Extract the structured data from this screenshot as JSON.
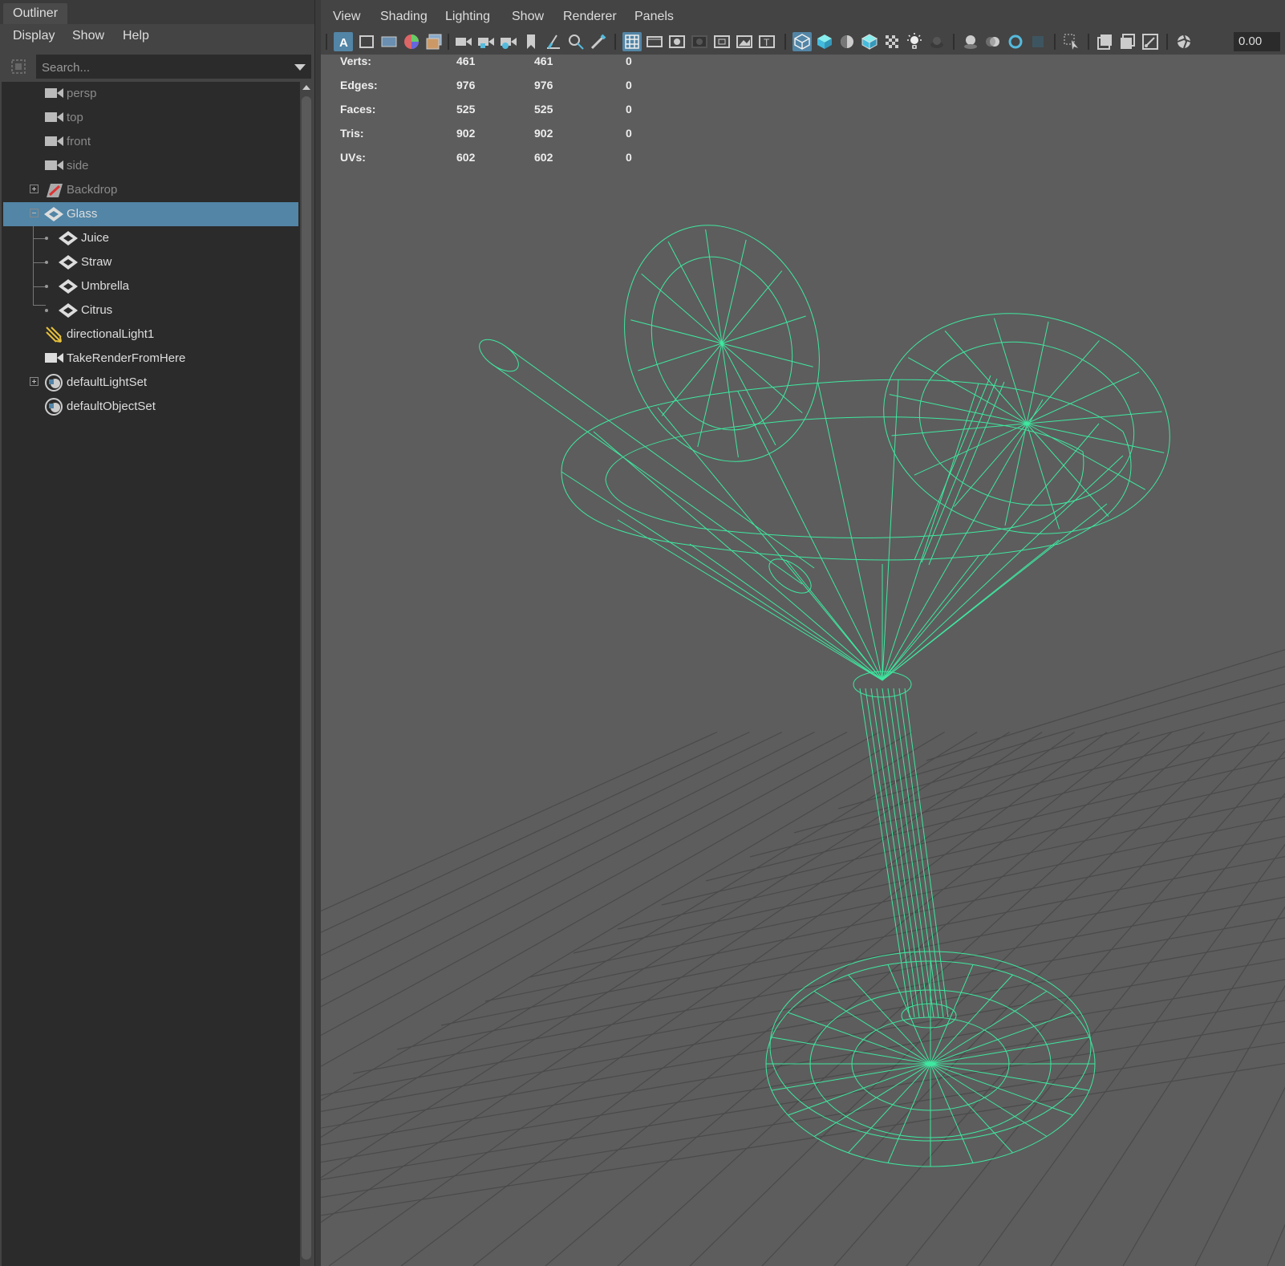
{
  "outliner": {
    "tab_title": "Outliner",
    "menu": [
      "Display",
      "Show",
      "Help"
    ],
    "search_placeholder": "Search...",
    "items": [
      {
        "label": "persp",
        "icon": "camera-icon"
      },
      {
        "label": "top",
        "icon": "camera-icon"
      },
      {
        "label": "front",
        "icon": "camera-icon"
      },
      {
        "label": "side",
        "icon": "camera-icon"
      },
      {
        "label": "Backdrop",
        "icon": "backdrop-icon"
      },
      {
        "label": "Glass",
        "icon": "mesh-icon",
        "selected": true
      },
      {
        "label": "Juice",
        "icon": "mesh-icon"
      },
      {
        "label": "Straw",
        "icon": "mesh-icon"
      },
      {
        "label": "Umbrella",
        "icon": "mesh-icon"
      },
      {
        "label": "Citrus",
        "icon": "mesh-icon"
      },
      {
        "label": "directionalLight1",
        "icon": "directional-light-icon"
      },
      {
        "label": "TakeRenderFromHere",
        "icon": "camera-icon"
      },
      {
        "label": "defaultLightSet",
        "icon": "set-icon"
      },
      {
        "label": "defaultObjectSet",
        "icon": "set-icon"
      }
    ]
  },
  "viewport": {
    "menu": [
      "View",
      "Shading",
      "Lighting",
      "Show",
      "Renderer",
      "Panels"
    ],
    "exposure_value": "0.00",
    "wireframe_color": "#3ee8a0",
    "selection_color": "#5285a6",
    "hud": {
      "rows": [
        {
          "label": "Verts:",
          "a": "461",
          "b": "461",
          "c": "0"
        },
        {
          "label": "Edges:",
          "a": "976",
          "b": "976",
          "c": "0"
        },
        {
          "label": "Faces:",
          "a": "525",
          "b": "525",
          "c": "0"
        },
        {
          "label": "Tris:",
          "a": "902",
          "b": "902",
          "c": "0"
        },
        {
          "label": "UVs:",
          "a": "602",
          "b": "602",
          "c": "0"
        }
      ]
    }
  }
}
